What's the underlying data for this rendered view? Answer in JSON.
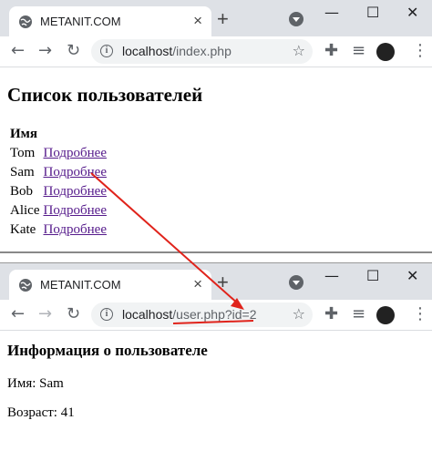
{
  "window1": {
    "tab_title": "METANIT.COM",
    "url_host": "localhost",
    "url_path": "/index.php",
    "page": {
      "title": "Список пользователей",
      "column_header": "Имя",
      "rows": [
        {
          "name": "Tom",
          "link": "Подробнее"
        },
        {
          "name": "Sam",
          "link": "Подробнее"
        },
        {
          "name": "Bob",
          "link": "Подробнее"
        },
        {
          "name": "Alice",
          "link": "Подробнее"
        },
        {
          "name": "Kate",
          "link": "Подробнее"
        }
      ]
    }
  },
  "window2": {
    "tab_title": "METANIT.COM",
    "url_host": "localhost",
    "url_path": "/user.php?id=2",
    "page": {
      "title": "Информация о пользователе",
      "name_line": "Имя: Sam",
      "age_line": "Возраст: 41"
    }
  },
  "icons": {
    "tab_close": "×",
    "new_tab": "+",
    "minimize": "—",
    "maximize": "☐",
    "close": "✕",
    "back": "←",
    "forward": "→",
    "reload": "↻",
    "info": "i",
    "star": "☆",
    "extensions": "✚",
    "reading_list": "≡",
    "menu": "⋮"
  },
  "colors": {
    "link": "#551a8b",
    "annotation": "#e0231b",
    "tabbar": "#dee1e6"
  }
}
